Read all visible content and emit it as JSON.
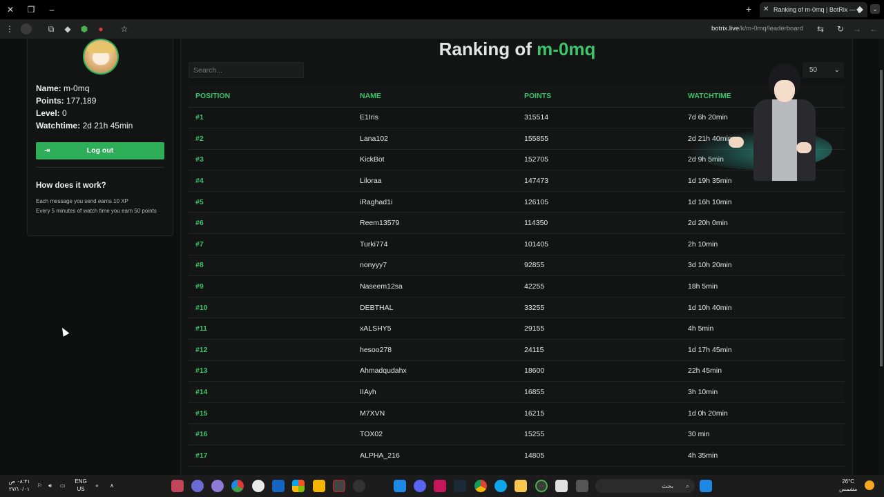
{
  "browser": {
    "tab_title": "Ranking of m-0mq | BotRix — (",
    "url_host": "botrix.live",
    "url_path": "/k/m-0mq/leaderboard"
  },
  "profile": {
    "name_label": "Name:",
    "name_value": "m-0mq",
    "points_label": "Points:",
    "points_value": "177,189",
    "level_label": "Level:",
    "level_value": "0",
    "watchtime_label": "Watchtime:",
    "watchtime_value": "2d 21h 45min",
    "logout_label": "Log out",
    "how_title": "How does it work?",
    "how_line1": "Each message you send earns 10 XP",
    "how_line2": "Every 5 minutes of watch time you earn 50 points"
  },
  "ranking": {
    "title_prefix": "Ranking of",
    "title_user": "m-0mq",
    "search_placeholder": "Search...",
    "page_size": "50",
    "headers": {
      "position": "POSITION",
      "name": "NAME",
      "points": "POINTS",
      "watchtime": "WATCHTIME"
    },
    "rows": [
      {
        "pos": "#1",
        "name": "E1Iris",
        "points": "315514",
        "watch": "7d 6h 20min"
      },
      {
        "pos": "#2",
        "name": "Lana102",
        "points": "155855",
        "watch": "2d 21h 40min"
      },
      {
        "pos": "#3",
        "name": "KickBot",
        "points": "152705",
        "watch": "2d 9h 5min"
      },
      {
        "pos": "#4",
        "name": "Liloraa",
        "points": "147473",
        "watch": "1d 19h 35min"
      },
      {
        "pos": "#5",
        "name": "iRaghad1i",
        "points": "126105",
        "watch": "1d 16h 10min"
      },
      {
        "pos": "#6",
        "name": "Reem13579",
        "points": "114350",
        "watch": "2d 20h 0min"
      },
      {
        "pos": "#7",
        "name": "Turki774",
        "points": "101405",
        "watch": "2h 10min"
      },
      {
        "pos": "#8",
        "name": "nonyyy7",
        "points": "92855",
        "watch": "3d 10h 20min"
      },
      {
        "pos": "#9",
        "name": "Naseem12sa",
        "points": "42255",
        "watch": "18h 5min"
      },
      {
        "pos": "#10",
        "name": "DEBTHAL",
        "points": "33255",
        "watch": "1d 10h 40min"
      },
      {
        "pos": "#11",
        "name": "xALSHY5",
        "points": "29155",
        "watch": "4h 5min"
      },
      {
        "pos": "#12",
        "name": "hesoo278",
        "points": "24115",
        "watch": "1d 17h 45min"
      },
      {
        "pos": "#13",
        "name": "Ahmadqudahx",
        "points": "18600",
        "watch": "22h 45min"
      },
      {
        "pos": "#14",
        "name": "IIAyh",
        "points": "16855",
        "watch": "3h 10min"
      },
      {
        "pos": "#15",
        "name": "M7XVN",
        "points": "16215",
        "watch": "1d 0h 20min"
      },
      {
        "pos": "#16",
        "name": "TOX02",
        "points": "15255",
        "watch": "30 min"
      },
      {
        "pos": "#17",
        "name": "ALPHA_216",
        "points": "14805",
        "watch": "4h 35min"
      }
    ]
  },
  "taskbar": {
    "time": "٠٨:٣١ ص",
    "date": "٢٧/١٠/٠١",
    "lang1": "ENG",
    "lang2": "US",
    "search_placeholder": "بحث",
    "temp": "26°C",
    "weather": "مشمس"
  }
}
